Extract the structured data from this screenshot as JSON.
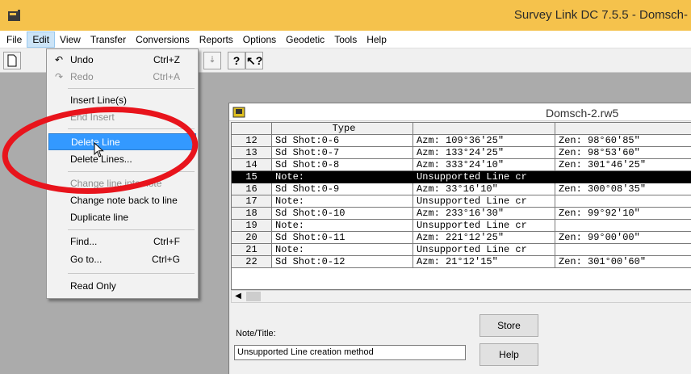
{
  "window": {
    "title": "Survey Link DC 7.5.5 - Domsch-"
  },
  "menubar": {
    "items": [
      "File",
      "Edit",
      "View",
      "Transfer",
      "Conversions",
      "Reports",
      "Options",
      "Geodetic",
      "Tools",
      "Help"
    ]
  },
  "toolbar": {
    "buttons": [
      "new-file-icon",
      "help-icon",
      "context-help-icon"
    ]
  },
  "edit_menu": {
    "items": [
      {
        "label": "Undo",
        "shortcut": "Ctrl+Z",
        "icon": "undo-icon",
        "enabled": true
      },
      {
        "label": "Redo",
        "shortcut": "Ctrl+A",
        "icon": "redo-icon",
        "enabled": false
      },
      {
        "label": "Insert Line(s)",
        "shortcut": "",
        "enabled": true
      },
      {
        "label": "End Insert",
        "shortcut": "",
        "enabled": false
      },
      {
        "label": "Delete Line",
        "shortcut": "",
        "enabled": true,
        "highlighted": true
      },
      {
        "label": "Delete Lines...",
        "shortcut": "",
        "enabled": true
      },
      {
        "label": "Change line into note",
        "shortcut": "",
        "enabled": false
      },
      {
        "label": "Change note back to line",
        "shortcut": "",
        "enabled": true
      },
      {
        "label": "Duplicate line",
        "shortcut": "",
        "enabled": true
      },
      {
        "label": "Find...",
        "shortcut": "Ctrl+F",
        "enabled": true
      },
      {
        "label": "Go to...",
        "shortcut": "Ctrl+G",
        "enabled": true
      },
      {
        "label": "Read Only",
        "shortcut": "",
        "enabled": true
      }
    ]
  },
  "child_window": {
    "title": "Domsch-2.rw5",
    "grid": {
      "header": [
        "",
        "Type",
        "",
        ""
      ],
      "rows": [
        [
          "12",
          "Sd Shot:0-6",
          "Azm: 109°36'25\"",
          "Zen: 98°60'85\""
        ],
        [
          "13",
          "Sd Shot:0-7",
          "Azm: 133°24'25\"",
          "Zen: 98°53'60\""
        ],
        [
          "14",
          "Sd Shot:0-8",
          "Azm: 333°24'10\"",
          "Zen: 301°46'25\""
        ],
        [
          "15",
          "Note:",
          "Unsupported Line cr",
          ""
        ],
        [
          "16",
          "Sd Shot:0-9",
          "Azm: 33°16'10\"",
          "Zen: 300°08'35\""
        ],
        [
          "17",
          "Note:",
          "Unsupported Line cr",
          ""
        ],
        [
          "18",
          "Sd Shot:0-10",
          "Azm: 233°16'30\"",
          "Zen: 99°92'10\""
        ],
        [
          "19",
          "Note:",
          "Unsupported Line cr",
          ""
        ],
        [
          "20",
          "Sd Shot:0-11",
          "Azm: 221°12'25\"",
          "Zen: 99°00'00\""
        ],
        [
          "21",
          "Note:",
          "Unsupported Line cr",
          ""
        ],
        [
          "22",
          "Sd Shot:0-12",
          "Azm: 21°12'15\"",
          "Zen: 301°00'60\""
        ]
      ],
      "selected_row_number": "15"
    },
    "note_label": "Note/Title:",
    "note_value": "Unsupported Line creation method",
    "store_label": "Store",
    "help_label": "Help"
  },
  "annotation": {
    "circle_color": "#e8141c"
  },
  "colors": {
    "titlebar": "#f5c24c",
    "menu_highlight": "#3399ff",
    "workspace": "#ababab"
  }
}
